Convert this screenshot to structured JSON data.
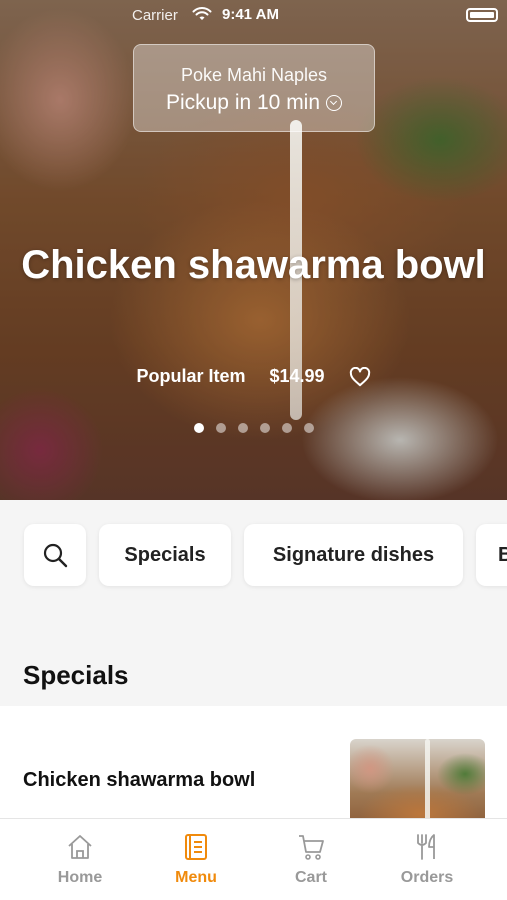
{
  "status": {
    "carrier": "Carrier",
    "time": "9:41 AM"
  },
  "store": {
    "name": "Poke Mahi Naples",
    "pickup": "Pickup in 10 min"
  },
  "hero": {
    "title": "Chicken shawarma bowl",
    "tag": "Popular Item",
    "price": "$14.99",
    "slide_count": 6,
    "active_slide": 1
  },
  "categories": [
    "Specials",
    "Signature dishes",
    "B"
  ],
  "section": {
    "title": "Specials"
  },
  "items": [
    {
      "name": "Chicken shawarma bowl"
    }
  ],
  "tabs": [
    {
      "label": "Home",
      "icon": "home-icon",
      "active": false
    },
    {
      "label": "Menu",
      "icon": "menu-icon",
      "active": true
    },
    {
      "label": "Cart",
      "icon": "cart-icon",
      "active": false
    },
    {
      "label": "Orders",
      "icon": "orders-icon",
      "active": false
    }
  ],
  "colors": {
    "accent": "#f08a0c",
    "inactive": "#999999"
  }
}
